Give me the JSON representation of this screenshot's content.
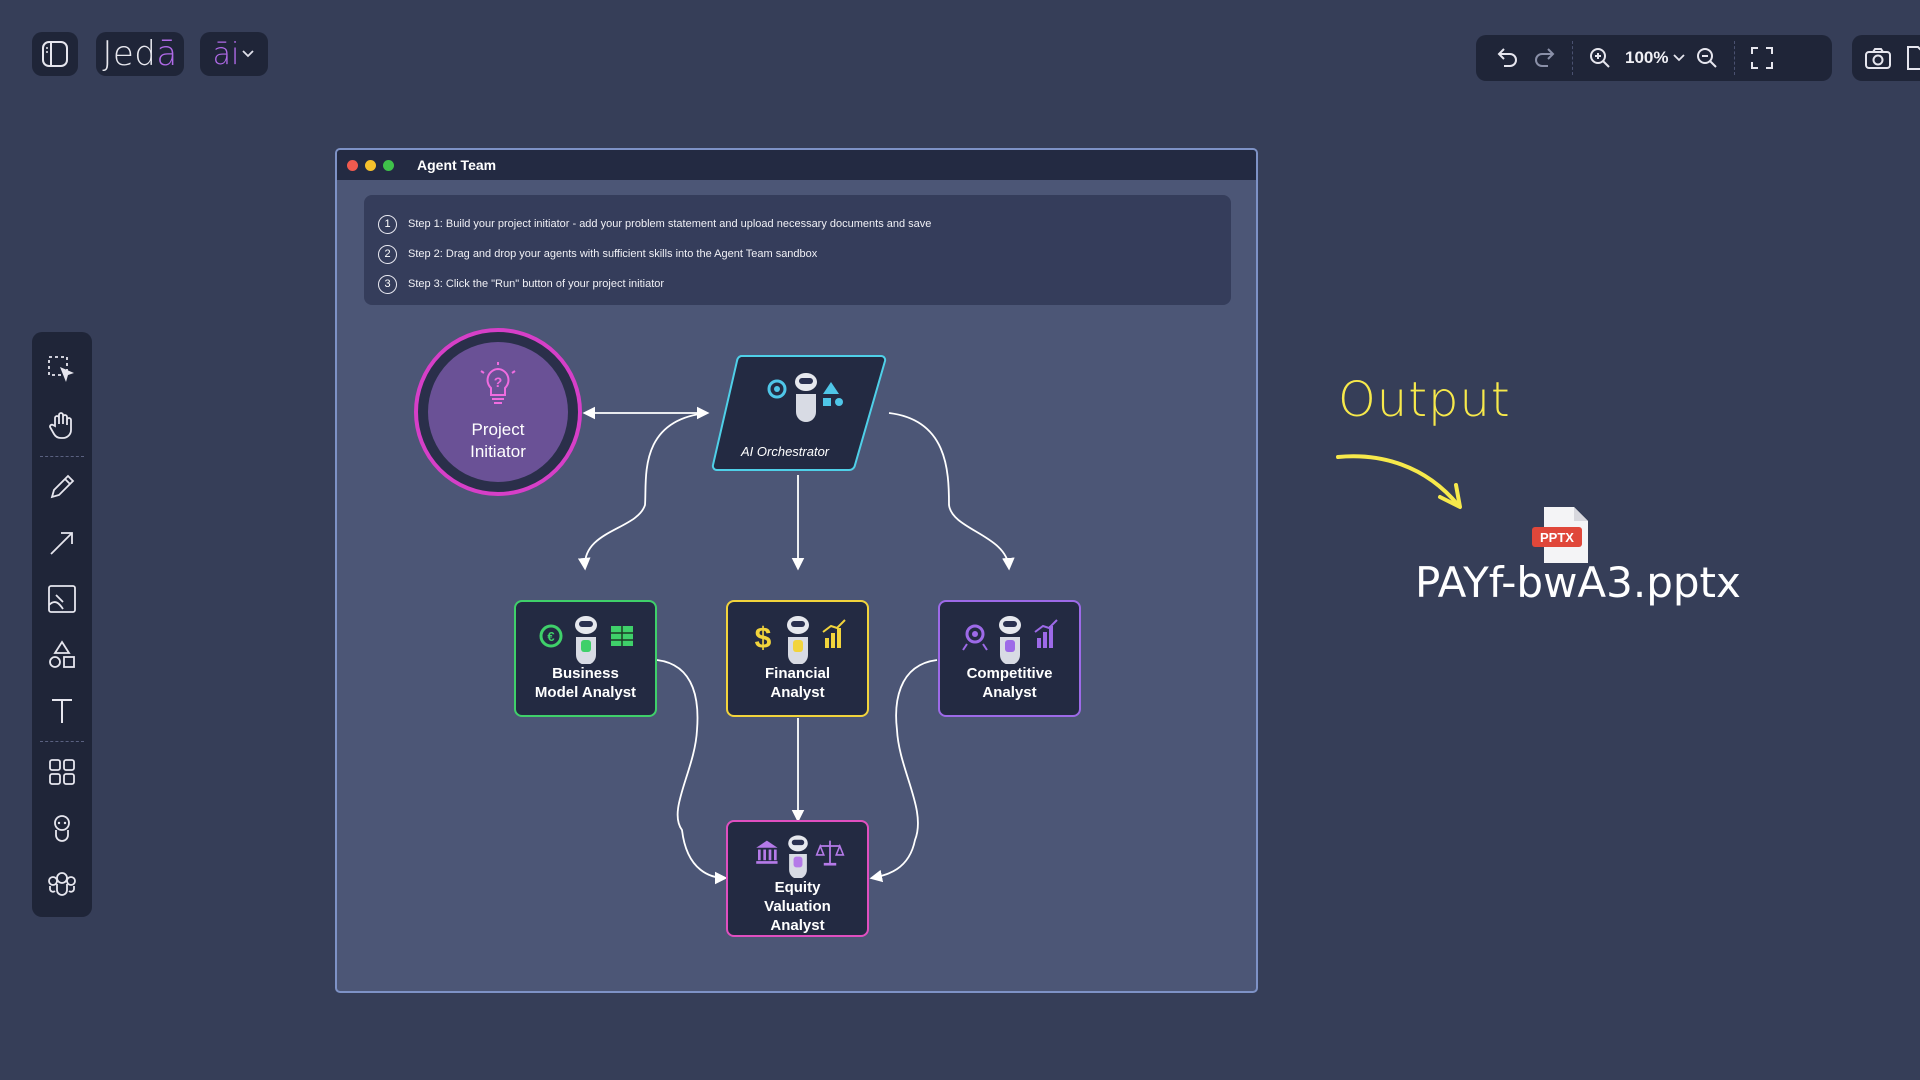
{
  "app": {
    "logo_text": "Jed",
    "logo_accent": "ā",
    "ai_label": "āi",
    "chevron": "⌄"
  },
  "toolbar": {
    "zoom_value": "100%",
    "icons": [
      "undo-icon",
      "redo-icon",
      "zoom-in-icon",
      "zoom-out-icon",
      "fullscreen-icon",
      "camera-icon",
      "export-icon"
    ]
  },
  "left_toolbar": {
    "tools": [
      "select-tool-icon",
      "hand-tool-icon",
      "pencil-tool-icon",
      "arrow-tool-icon",
      "image-tool-icon",
      "shapes-tool-icon",
      "text-tool-icon",
      "templates-icon",
      "agent-icon",
      "agent-team-icon"
    ]
  },
  "window": {
    "title": "Agent Team",
    "steps": [
      {
        "num": "1",
        "text": "Step 1: Build your project initiator - add your problem statement and upload necessary documents and save"
      },
      {
        "num": "2",
        "text": "Step 2: Drag and drop your agents with sufficient skills into the Agent Team sandbox"
      },
      {
        "num": "3",
        "text": "Step 3: Click the \"Run\" button of your project initiator"
      }
    ]
  },
  "diagram": {
    "initiator": {
      "line1": "Project",
      "line2": "Initiator"
    },
    "orchestrator": {
      "label": "AI Orchestrator"
    },
    "agents": {
      "business": {
        "line1": "Business",
        "line2": "Model Analyst",
        "color": "#3fd06a"
      },
      "financial": {
        "line1": "Financial",
        "line2": "Analyst",
        "color": "#f2d43c"
      },
      "competitive": {
        "line1": "Competitive",
        "line2": "Analyst",
        "color": "#9d6ae8"
      },
      "equity": {
        "line1": "Equity",
        "line2": "Valuation",
        "line3": "Analyst",
        "color": "#e04fc0"
      }
    }
  },
  "output": {
    "label": "Output",
    "badge": "PPTX",
    "file_name": "PAYf-bwA3.pptx"
  },
  "colors": {
    "background": "#363e58",
    "panel": "#1f2538",
    "accent_purple": "#b06ae8",
    "output_yellow": "#f7e94b",
    "initiator_pink": "#d63fc8",
    "orchestrator_cyan": "#4fd0e8"
  }
}
